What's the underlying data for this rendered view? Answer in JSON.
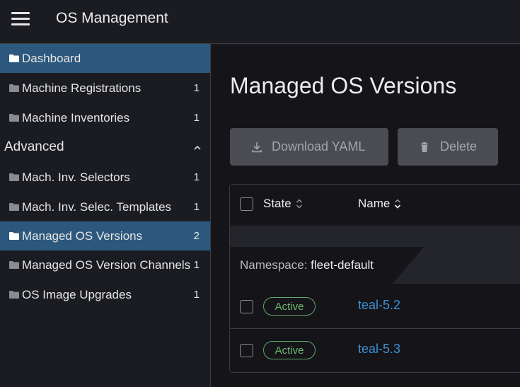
{
  "header": {
    "title": "OS Management"
  },
  "sidebar": {
    "items": [
      {
        "label": "Dashboard",
        "count": ""
      },
      {
        "label": "Machine Registrations",
        "count": "1"
      },
      {
        "label": "Machine Inventories",
        "count": "1"
      }
    ],
    "group": {
      "label": "Advanced",
      "expanded": true
    },
    "advanced_items": [
      {
        "label": "Mach. Inv. Selectors",
        "count": "1"
      },
      {
        "label": "Mach. Inv. Selec. Templates",
        "count": "1"
      },
      {
        "label": "Managed OS Versions",
        "count": "2"
      },
      {
        "label": "Managed OS Version Channels",
        "count": "1"
      },
      {
        "label": "OS Image Upgrades",
        "count": "1"
      }
    ],
    "active_item": "Managed OS Versions"
  },
  "main": {
    "title": "Managed OS Versions",
    "buttons": {
      "download": "Download YAML",
      "delete": "Delete"
    },
    "table": {
      "columns": [
        "State",
        "Name"
      ],
      "namespace_label": "Namespace:",
      "namespace_value": "fleet-default",
      "rows": [
        {
          "state": "Active",
          "name": "teal-5.2"
        },
        {
          "state": "Active",
          "name": "teal-5.3"
        }
      ]
    }
  },
  "colors": {
    "active_nav": "#2d587d",
    "link": "#3f8fd1",
    "badge_active": "#62a867",
    "button_bg": "#4b4c52"
  },
  "icons": [
    "menu-icon",
    "folder-icon",
    "chevron-up-icon",
    "download-icon",
    "trash-icon",
    "sort-icon"
  ]
}
